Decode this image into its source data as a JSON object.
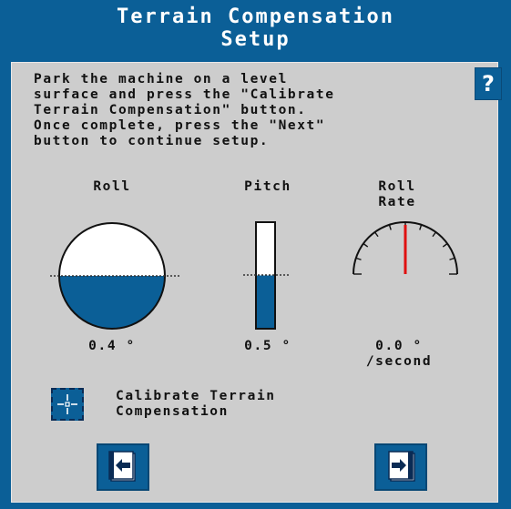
{
  "header": {
    "title_line1": "Terrain Compensation",
    "title_line2": "Setup"
  },
  "instructions": {
    "lines": [
      "Park the machine on a level",
      "surface and press the \"Calibrate",
      "Terrain Compensation\" button.",
      "Once complete, press the \"Next\"",
      "button to continue setup."
    ]
  },
  "help_button": {
    "label": "?",
    "icon": "question-icon"
  },
  "gauges": {
    "roll": {
      "label": "Roll",
      "value": "0.4 °",
      "fill_fraction": 0.5
    },
    "pitch": {
      "label": "Pitch",
      "value": "0.5 °",
      "fill_fraction": 0.5
    },
    "roll_rate": {
      "label_line1": "Roll",
      "label_line2": "Rate",
      "value_line1": "0.0 °",
      "value_line2": "/second",
      "needle_value": 0.0
    }
  },
  "calibrate": {
    "label_line1": "Calibrate Terrain",
    "label_line2": "Compensation",
    "icon": "crosshair-icon"
  },
  "navigation": {
    "back_icon": "back-arrow-icon",
    "next_icon": "next-arrow-icon"
  },
  "colors": {
    "brand_blue": "#0b5f97",
    "panel_gray": "#cdcdcd",
    "needle_red": "#e01010"
  }
}
